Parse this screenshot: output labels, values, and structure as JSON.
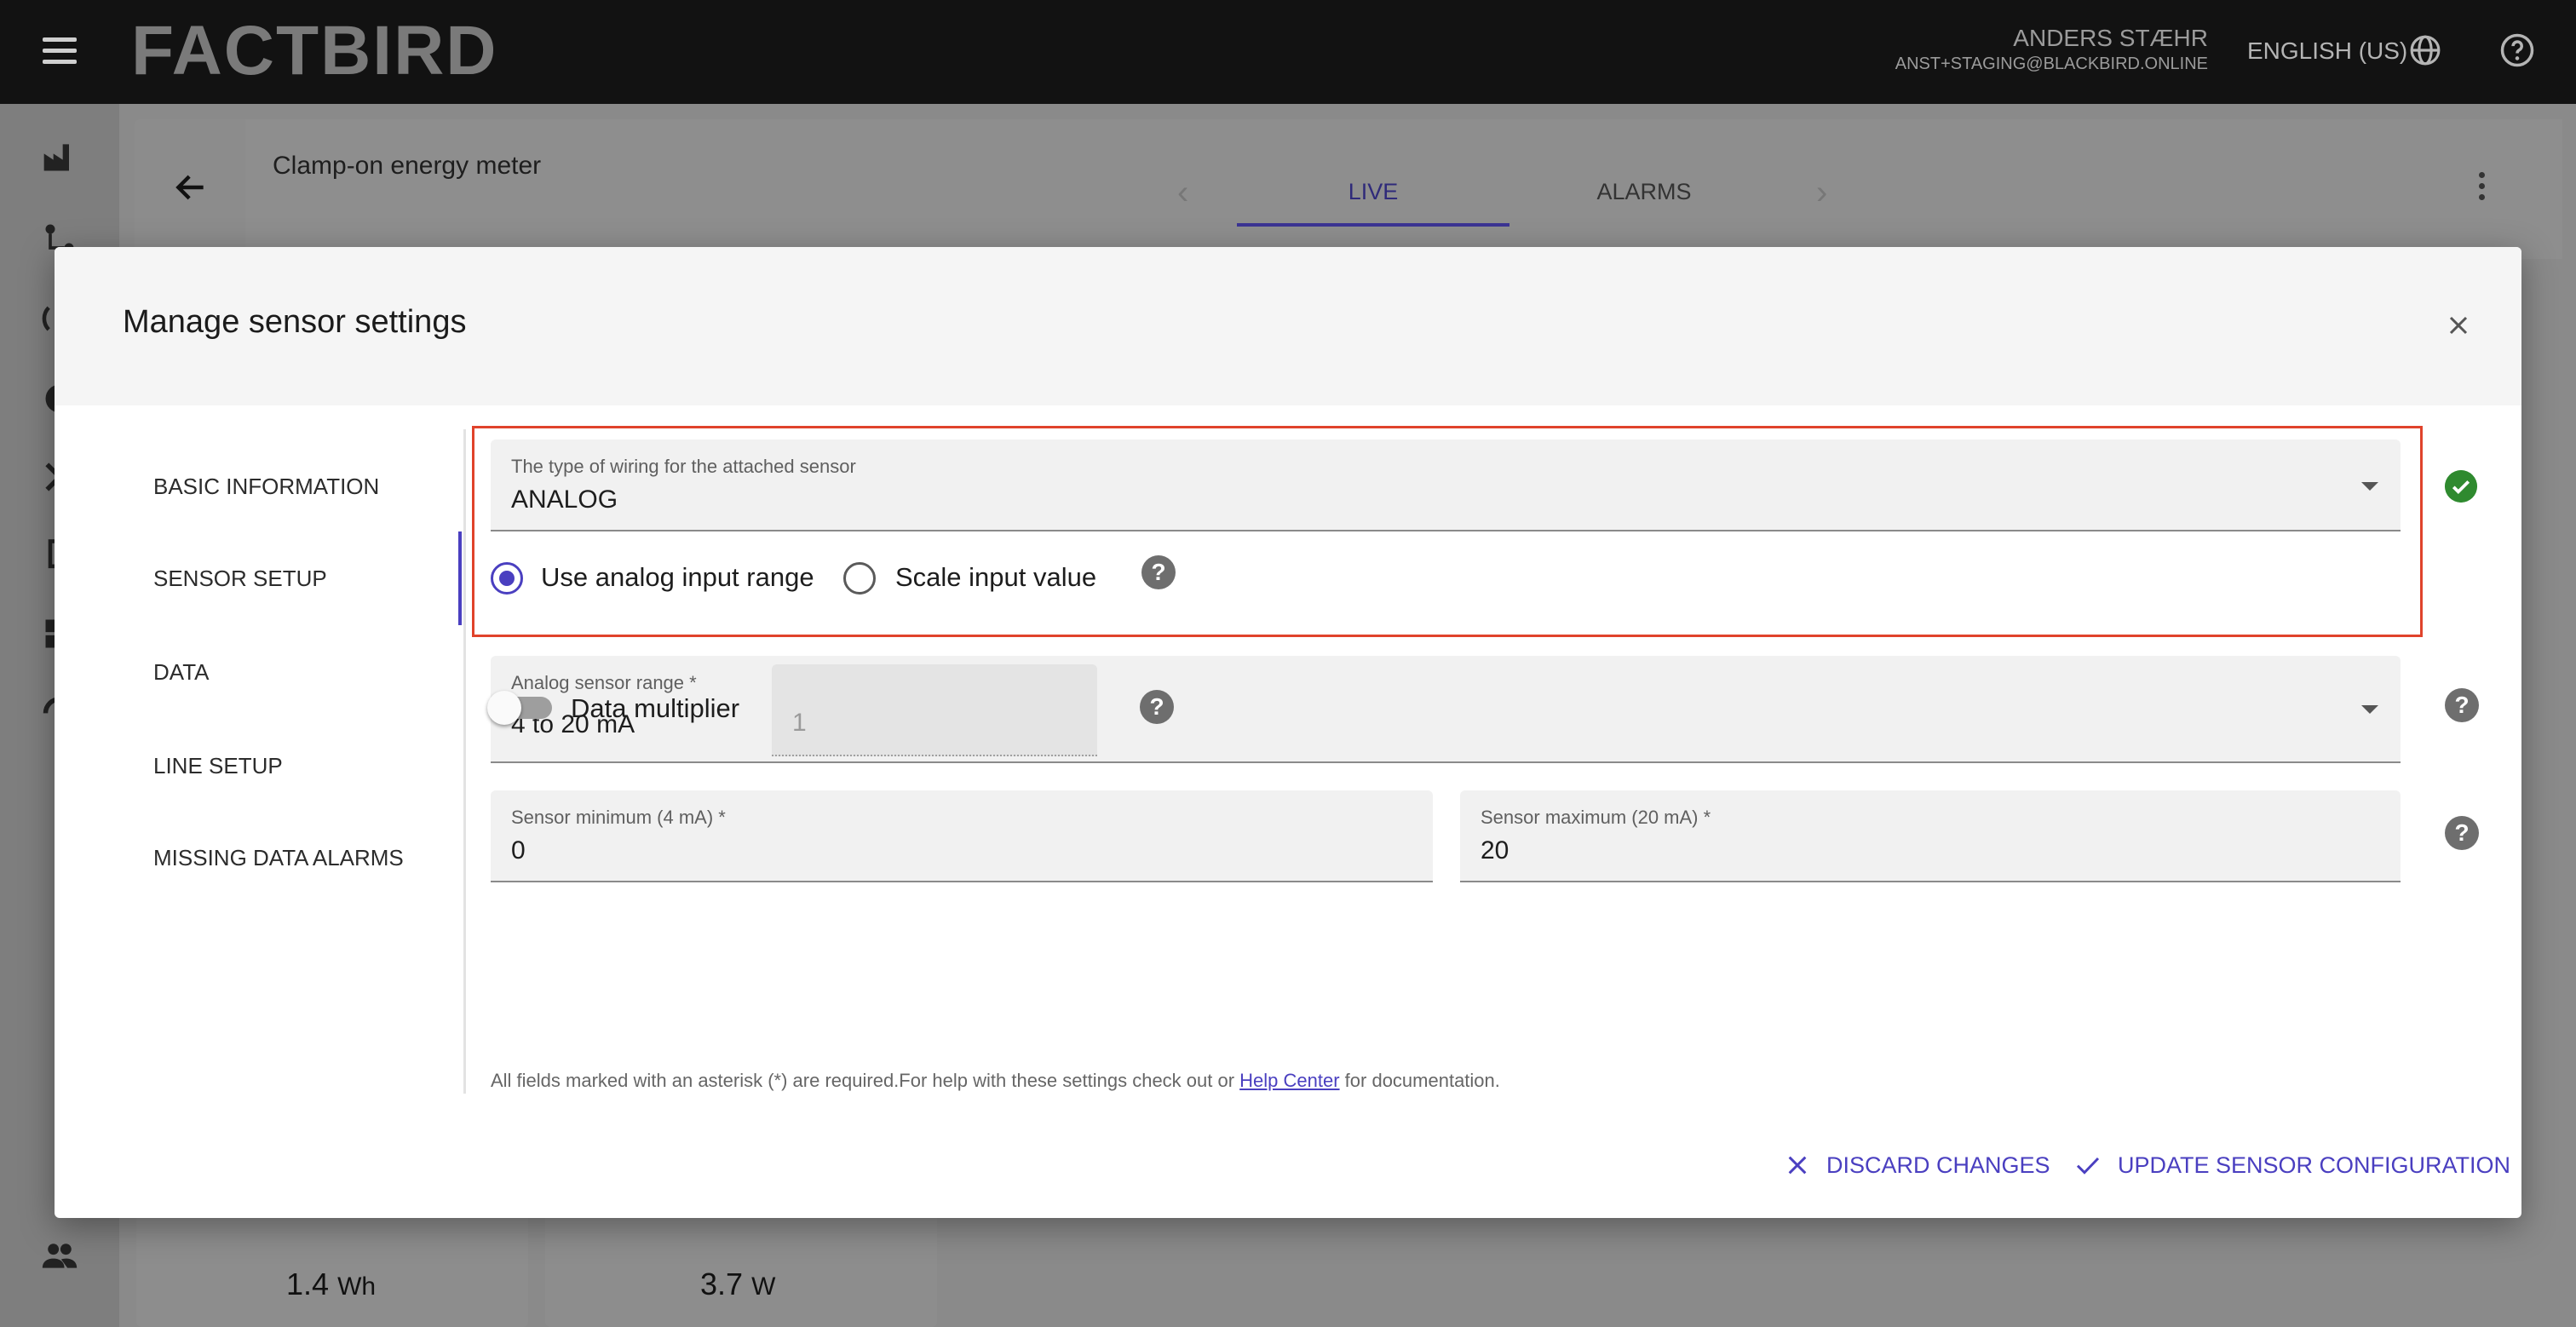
{
  "app": {
    "logo": "FACTBIRD",
    "user_name": "ANDERS STÆHR",
    "user_email": "ANST+STAGING@BLACKBIRD.ONLINE",
    "language": "ENGLISH (US)"
  },
  "page": {
    "title": "Clamp-on energy meter",
    "tabs": [
      {
        "label": "LIVE",
        "active": true
      },
      {
        "label": "ALARMS",
        "active": false
      }
    ],
    "cards": [
      {
        "value": "1.4",
        "unit": "Wh"
      },
      {
        "value": "3.7",
        "unit": "W"
      }
    ]
  },
  "dialog": {
    "title": "Manage sensor settings",
    "nav": [
      {
        "label": "BASIC INFORMATION"
      },
      {
        "label": "SENSOR SETUP",
        "active": true
      },
      {
        "label": "DATA"
      },
      {
        "label": "LINE SETUP"
      },
      {
        "label": "MISSING DATA ALARMS"
      }
    ],
    "wiring": {
      "label": "The type of wiring for the attached sensor",
      "value": "ANALOG"
    },
    "radio": {
      "option1": "Use analog input range",
      "option2": "Scale input value",
      "selected": "option1"
    },
    "analog_range": {
      "label": "Analog sensor range *",
      "value": "4 to 20 mA"
    },
    "sensor_min": {
      "label": "Sensor minimum (4 mA) *",
      "value": "0"
    },
    "sensor_max": {
      "label": "Sensor maximum (20 mA) *",
      "value": "20"
    },
    "multiplier": {
      "label": "Data multiplier",
      "value": "1",
      "enabled": false
    },
    "footnote": {
      "before": "All fields marked with an asterisk (*) are required.For help with these settings check out or ",
      "link": "Help Center",
      "after": " for documentation."
    },
    "actions": {
      "discard": "DISCARD CHANGES",
      "update": "UPDATE SENSOR CONFIGURATION"
    }
  },
  "colors": {
    "accent": "#4a3fc0",
    "highlight": "#e0432b",
    "success": "#2f8a2f"
  }
}
